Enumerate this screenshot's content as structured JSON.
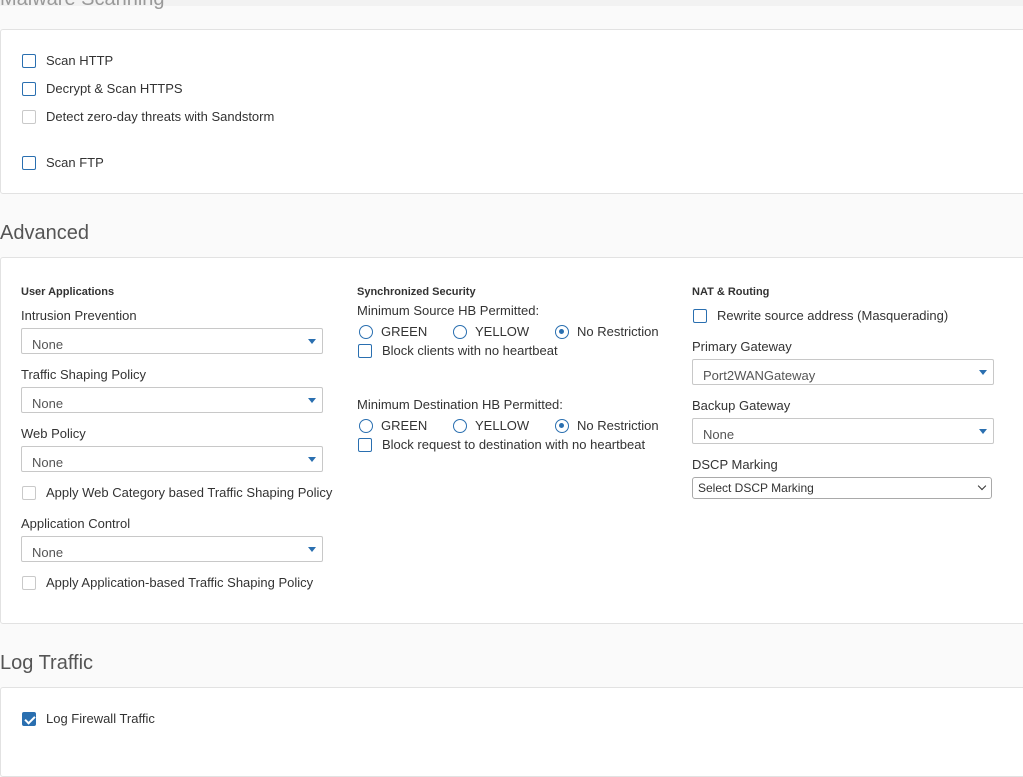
{
  "malware_scanning": {
    "title": "Malware Scanning",
    "scan_http": {
      "label": "Scan HTTP",
      "checked": false
    },
    "decrypt_scan_https": {
      "label": "Decrypt & Scan HTTPS",
      "checked": false
    },
    "sandstorm": {
      "label": "Detect zero-day threats with Sandstorm",
      "checked": false,
      "disabled": true
    },
    "scan_ftp": {
      "label": "Scan FTP",
      "checked": false
    }
  },
  "advanced": {
    "title": "Advanced",
    "user_applications": {
      "heading": "User Applications",
      "intrusion_prevention": {
        "label": "Intrusion Prevention",
        "value": "None"
      },
      "traffic_shaping_policy": {
        "label": "Traffic Shaping Policy",
        "value": "None"
      },
      "web_policy": {
        "label": "Web Policy",
        "value": "None"
      },
      "apply_web_category_shaping": {
        "label": "Apply Web Category based Traffic Shaping Policy",
        "checked": false
      },
      "application_control": {
        "label": "Application Control",
        "value": "None"
      },
      "apply_application_shaping": {
        "label": "Apply Application-based Traffic Shaping Policy",
        "checked": false
      }
    },
    "synchronized_security": {
      "heading": "Synchronized Security",
      "min_source_hb": {
        "label": "Minimum Source HB Permitted:",
        "options": [
          "GREEN",
          "YELLOW",
          "No Restriction"
        ],
        "selected": "No Restriction"
      },
      "block_clients_no_heartbeat": {
        "label": "Block clients with no heartbeat",
        "checked": false
      },
      "min_destination_hb": {
        "label": "Minimum Destination HB Permitted:",
        "options": [
          "GREEN",
          "YELLOW",
          "No Restriction"
        ],
        "selected": "No Restriction"
      },
      "block_request_no_heartbeat": {
        "label": "Block request to destination with no heartbeat",
        "checked": false
      }
    },
    "nat_routing": {
      "heading": "NAT & Routing",
      "rewrite_source": {
        "label": "Rewrite source address (Masquerading)",
        "checked": false
      },
      "primary_gateway": {
        "label": "Primary Gateway",
        "value": "Port2WANGateway"
      },
      "backup_gateway": {
        "label": "Backup Gateway",
        "value": "None"
      },
      "dscp_marking": {
        "label": "DSCP Marking",
        "value": "Select DSCP Marking"
      }
    }
  },
  "log_traffic": {
    "title": "Log Traffic",
    "log_firewall_traffic": {
      "label": "Log Firewall Traffic",
      "checked": true
    }
  },
  "colors": {
    "accent": "#2a6fb0",
    "disabled_border": "#c9c9c9"
  }
}
